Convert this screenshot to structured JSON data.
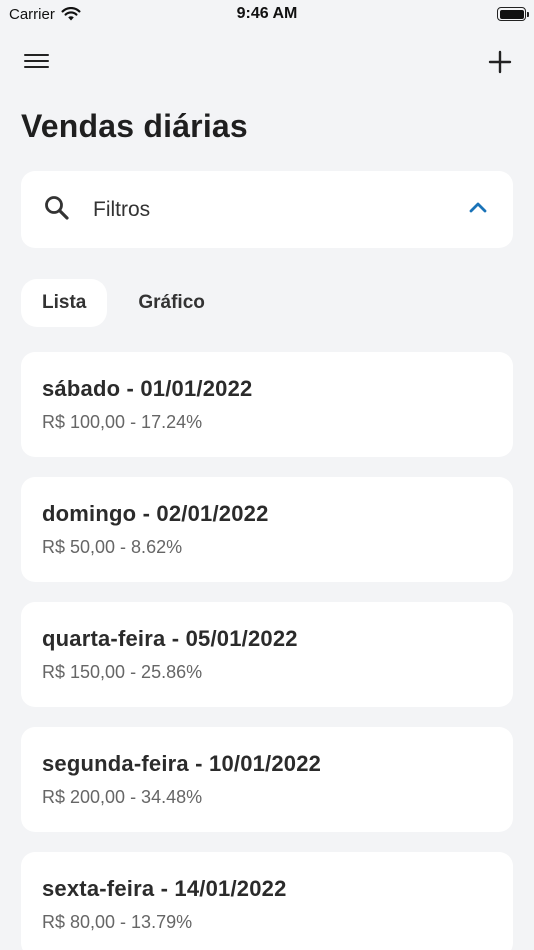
{
  "status_bar": {
    "carrier": "Carrier",
    "time": "9:46 AM"
  },
  "header": {
    "title": "Vendas diárias",
    "menu_icon": "hamburger-menu-icon",
    "add_icon": "plus-icon"
  },
  "filter": {
    "label": "Filtros",
    "icon": "search-icon",
    "chevron": "chevron-up-icon",
    "accent_color": "#1a73b8"
  },
  "tabs": [
    {
      "label": "Lista",
      "active": true
    },
    {
      "label": "Gráfico",
      "active": false
    }
  ],
  "sales": [
    {
      "title": "sábado - 01/01/2022",
      "detail": "R$ 100,00 - 17.24%"
    },
    {
      "title": "domingo - 02/01/2022",
      "detail": "R$ 50,00 - 8.62%"
    },
    {
      "title": "quarta-feira - 05/01/2022",
      "detail": "R$ 150,00 - 25.86%"
    },
    {
      "title": "segunda-feira - 10/01/2022",
      "detail": "R$ 200,00 - 34.48%"
    },
    {
      "title": "sexta-feira - 14/01/2022",
      "detail": "R$ 80,00 - 13.79%"
    }
  ]
}
